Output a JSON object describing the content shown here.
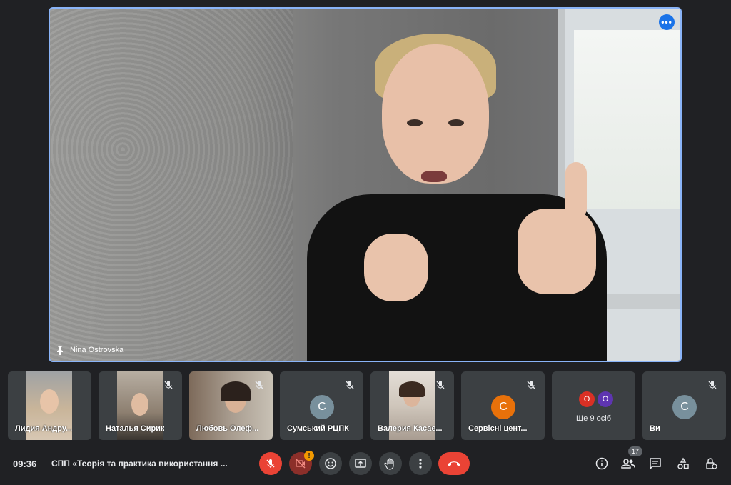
{
  "main_video": {
    "speaker_name": "Nina Ostrovska",
    "pin_icon": "pin-icon",
    "more_icon": "more-horiz-icon"
  },
  "tiles": [
    {
      "name": "Лидия Андру...",
      "type": "video",
      "mic_muted": false
    },
    {
      "name": "Наталья Сирик",
      "type": "video",
      "mic_muted": true
    },
    {
      "name": "Любовь Олеф...",
      "type": "video",
      "mic_muted": true
    },
    {
      "name": "Сумський РЦПК",
      "type": "avatar",
      "initial": "С",
      "avatar_color": "#78909c",
      "mic_muted": true
    },
    {
      "name": "Валерия Касае...",
      "type": "video",
      "mic_muted": true
    },
    {
      "name": "Сервісні цент...",
      "type": "avatar",
      "initial": "С",
      "avatar_color": "#e8710a",
      "mic_muted": true
    },
    {
      "name": "Ще 9 осіб",
      "type": "more",
      "minis": [
        {
          "initial": "О",
          "color": "#d93025"
        },
        {
          "initial": "О",
          "color": "#5e35b1"
        }
      ]
    },
    {
      "name": "Ви",
      "type": "avatar",
      "initial": "С",
      "avatar_color": "#78909c",
      "mic_muted": true
    }
  ],
  "bottom_bar": {
    "time": "09:36",
    "meeting_title": "СПП «Теорія та практика використання ...",
    "warning_badge": "!",
    "participants_count": "17",
    "controls": [
      "mic-off-icon",
      "camera-off-icon",
      "emoji-icon",
      "present-screen-icon",
      "raise-hand-icon",
      "more-vert-icon",
      "end-call-icon"
    ],
    "right_icons": [
      "info-icon",
      "people-icon",
      "chat-icon",
      "activities-icon",
      "host-controls-icon"
    ]
  },
  "colors": {
    "background": "#202124",
    "tile": "#3c4043",
    "accent": "#8ab4f8",
    "danger": "#ea4335"
  }
}
